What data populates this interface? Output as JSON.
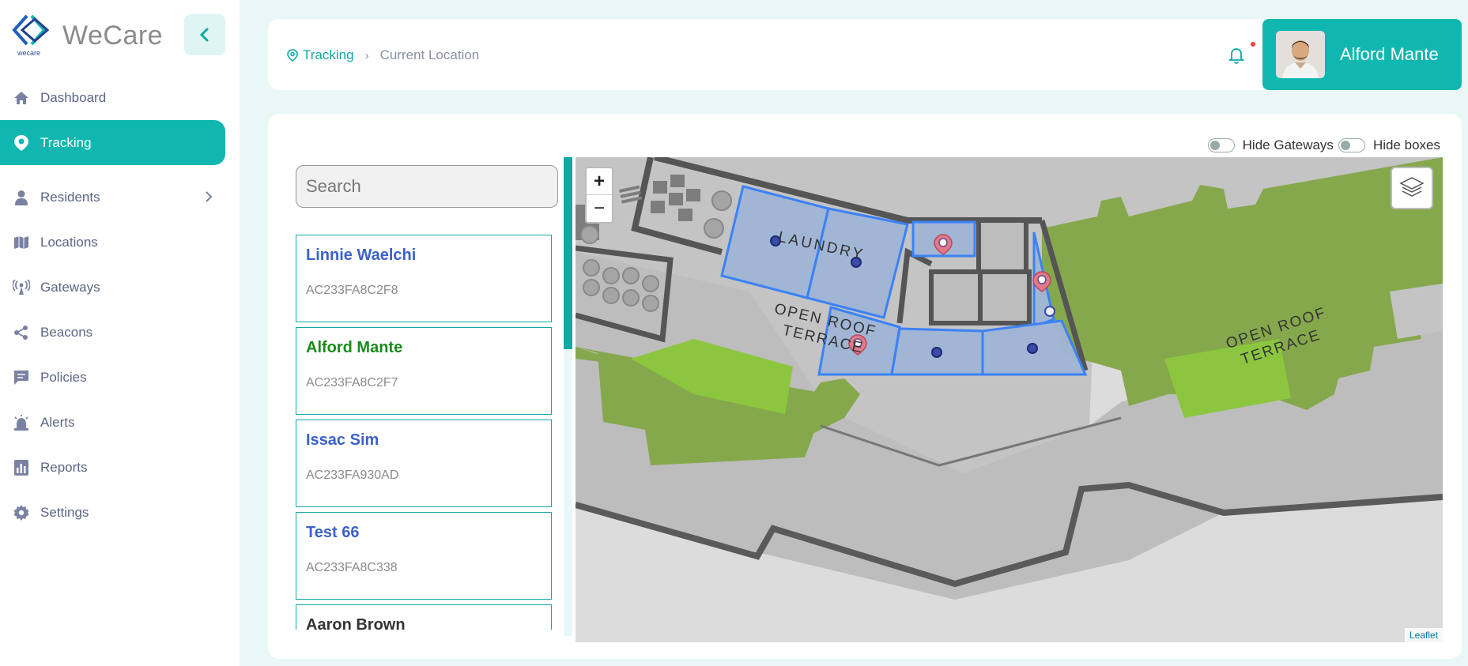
{
  "app": {
    "name": "WeCare",
    "sub": "wecare"
  },
  "nav": [
    {
      "label": "Dashboard",
      "icon": "home-icon"
    },
    {
      "label": "Tracking",
      "icon": "location-pin-icon",
      "active": true
    },
    {
      "label": "Residents",
      "icon": "person-icon",
      "has_children": true
    },
    {
      "label": "Locations",
      "icon": "map-icon"
    },
    {
      "label": "Gateways",
      "icon": "broadcast-icon"
    },
    {
      "label": "Beacons",
      "icon": "share-icon"
    },
    {
      "label": "Policies",
      "icon": "comment-icon"
    },
    {
      "label": "Alerts",
      "icon": "alarm-icon"
    },
    {
      "label": "Reports",
      "icon": "bar-chart-icon"
    },
    {
      "label": "Settings",
      "icon": "gear-icon"
    }
  ],
  "header": {
    "breadcrumb_root": "Tracking",
    "breadcrumb_current": "Current Location",
    "user_name": "Alford Mante"
  },
  "toggles": {
    "hide_gateways": "Hide Gateways",
    "hide_boxes": "Hide boxes"
  },
  "search": {
    "placeholder": "Search"
  },
  "residents": [
    {
      "name": "Linnie Waelchi",
      "id": "AC233FA8C2F8",
      "color": "#3b62c9"
    },
    {
      "name": "Alford Mante",
      "id": "AC233FA8C2F7",
      "color": "#1a8a1a"
    },
    {
      "name": "Issac Sim",
      "id": "AC233FA930AD",
      "color": "#3b62c9"
    },
    {
      "name": "Test 66",
      "id": "AC233FA8C338",
      "color": "#3b62c9"
    },
    {
      "name": "Aaron Brown",
      "id": "",
      "color": "#333333"
    }
  ],
  "map": {
    "zoom_in": "+",
    "zoom_out": "−",
    "labels": {
      "laundry": "LAUNDRY",
      "terrace_line1": "OPEN ROOF",
      "terrace_line2": "TERRACE"
    },
    "attribution": "Leaflet"
  },
  "colors": {
    "accent": "#10b7b0",
    "zone_fill": "#9fb4d6",
    "zone_stroke": "#3b82f6",
    "green": "#86a84c"
  }
}
